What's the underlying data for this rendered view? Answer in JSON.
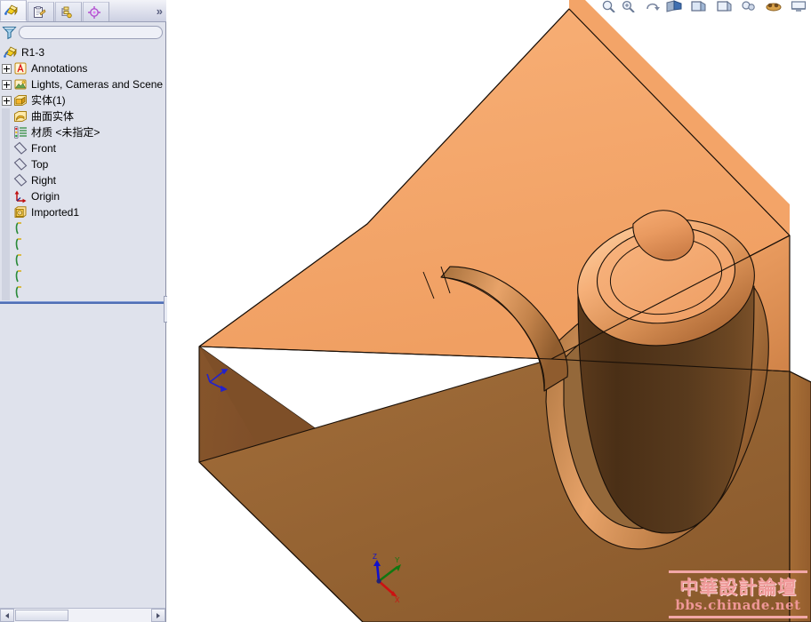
{
  "window": {
    "title": "R1-3"
  },
  "left_panel": {
    "tabs": [
      {
        "id": "feature-manager",
        "label": "FeatureManager design tree",
        "icon": "feature-tree-icon",
        "active": true
      },
      {
        "id": "property-manager",
        "label": "PropertyManager",
        "icon": "property-clipboard-icon",
        "active": false
      },
      {
        "id": "configuration-manager",
        "label": "ConfigurationManager",
        "icon": "configuration-icon",
        "active": false
      },
      {
        "id": "display-manager",
        "label": "DisplayManager",
        "icon": "display-target-icon",
        "active": false
      }
    ],
    "overflow_label": "»",
    "filter": {
      "icon": "filter-funnel-icon",
      "value": "",
      "placeholder": ""
    },
    "tree": [
      {
        "label": "R1-3",
        "icon": "part-icon",
        "indent": 0,
        "expander": "none"
      },
      {
        "label": "Annotations",
        "icon": "annotations-icon",
        "indent": 1,
        "expander": "plus"
      },
      {
        "label": "Lights, Cameras and Scene",
        "icon": "lights-icon",
        "indent": 1,
        "expander": "plus"
      },
      {
        "label": "实体(1)",
        "icon": "solid-bodies-icon",
        "indent": 1,
        "expander": "plus"
      },
      {
        "label": "曲面实体",
        "icon": "surface-bodies-icon",
        "indent": 1,
        "expander": "none"
      },
      {
        "label": "材质 <未指定>",
        "icon": "material-icon",
        "indent": 1,
        "expander": "none"
      },
      {
        "label": "Front",
        "icon": "plane-icon",
        "indent": 1,
        "expander": "none"
      },
      {
        "label": "Top",
        "icon": "plane-icon",
        "indent": 1,
        "expander": "none"
      },
      {
        "label": "Right",
        "icon": "plane-icon",
        "indent": 1,
        "expander": "none"
      },
      {
        "label": "Origin",
        "icon": "origin-icon",
        "indent": 1,
        "expander": "none"
      },
      {
        "label": "Imported1",
        "icon": "imported-icon",
        "indent": 1,
        "expander": "none"
      },
      {
        "label": "",
        "icon": "sketch-icon",
        "indent": 1,
        "expander": "none"
      },
      {
        "label": "",
        "icon": "sketch-icon",
        "indent": 1,
        "expander": "none"
      },
      {
        "label": "",
        "icon": "sketch-icon",
        "indent": 1,
        "expander": "none"
      },
      {
        "label": "",
        "icon": "sketch-icon",
        "indent": 1,
        "expander": "none"
      },
      {
        "label": "",
        "icon": "sketch-icon",
        "indent": 1,
        "expander": "none"
      }
    ],
    "splitter": {
      "name": "panel-splitter-handle"
    },
    "hscrollbar": {
      "left_arrow": "◄",
      "right_arrow": "►"
    }
  },
  "view_toolbar": {
    "buttons": [
      {
        "id": "zoom-to-fit",
        "icon": "magnifier-fit-icon"
      },
      {
        "id": "zoom-to-area",
        "icon": "magnifier-area-icon"
      },
      {
        "id": "previous-view",
        "icon": "previous-view-icon"
      },
      {
        "id": "section-view",
        "icon": "section-view-icon"
      },
      {
        "id": "view-orientation",
        "icon": "view-orientation-icon"
      },
      {
        "id": "display-style",
        "icon": "display-style-icon"
      },
      {
        "id": "hide-show-items",
        "icon": "hide-show-icon"
      },
      {
        "id": "appearance",
        "icon": "appearance-icon"
      },
      {
        "id": "scene-backdrop",
        "icon": "scene-icon"
      }
    ]
  },
  "viewport": {
    "background": "#ffffff",
    "model_name": "R1-3",
    "colors": {
      "face_top_light": "#f5a96c",
      "face_top_light2": "#f3a468",
      "face_front_dark": "#7e4f28",
      "face_right_mid": "#a26a36",
      "face_chamfer": "#e3955c",
      "cylinder_dark": "#4f3118",
      "cylinder_highlight": "#f7c795",
      "edge": "#1a1008"
    },
    "origin_marker": {
      "name": "model-origin",
      "color": "#2222cc"
    },
    "triad": {
      "x_label": "X",
      "y_label": "Y",
      "z_label": "Z",
      "x_color": "#cc1111",
      "y_color": "#117711",
      "z_color": "#1111cc"
    }
  },
  "watermark": {
    "title": "中華設計論壇",
    "url": "bbs.chinade.net",
    "color": "#f09a9a"
  }
}
